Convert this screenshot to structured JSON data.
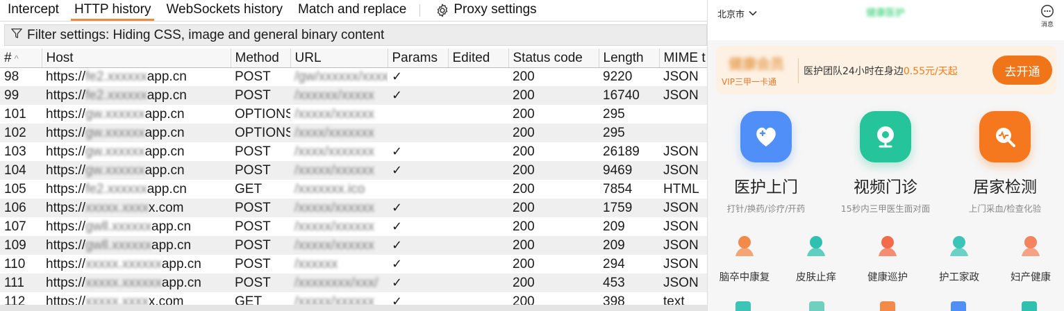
{
  "proxy": {
    "tabs": [
      "Intercept",
      "HTTP history",
      "WebSockets history",
      "Match and replace"
    ],
    "settings_label": "Proxy settings",
    "filter": "Filter settings: Hiding CSS, image and general binary content",
    "columns": [
      "#",
      "Host",
      "Method",
      "URL",
      "Params",
      "Edited",
      "Status code",
      "Length",
      "MIME t"
    ],
    "rows": [
      {
        "num": "98",
        "host": "https://fe2.xxxxxxapp.cn",
        "method": "POST",
        "url": "/gw/xxxxxx/xxxxx",
        "params": "✓",
        "status": "200",
        "length": "9220",
        "mime": "JSON"
      },
      {
        "num": "99",
        "host": "https://fe2.xxxxxxapp.cn",
        "method": "POST",
        "url": "/xxxxxx/xxxxx",
        "params": "✓",
        "status": "200",
        "length": "16740",
        "mime": "JSON"
      },
      {
        "num": "101",
        "host": "https://gw.xxxxxxapp.cn",
        "method": "OPTIONS",
        "url": "/xxxxx/xxxxxx",
        "params": "",
        "status": "200",
        "length": "295",
        "mime": ""
      },
      {
        "num": "102",
        "host": "https://gw.xxxxxxapp.cn",
        "method": "OPTIONS",
        "url": "/xxxx/xxxxxxx",
        "params": "",
        "status": "200",
        "length": "295",
        "mime": ""
      },
      {
        "num": "103",
        "host": "https://gw.xxxxxxapp.cn",
        "method": "POST",
        "url": "/xxxx/xxxxxxx",
        "params": "✓",
        "status": "200",
        "length": "26189",
        "mime": "JSON"
      },
      {
        "num": "104",
        "host": "https://gw.xxxxxxapp.cn",
        "method": "POST",
        "url": "/xxxxx/xxxxxx",
        "params": "✓",
        "status": "200",
        "length": "9469",
        "mime": "JSON"
      },
      {
        "num": "105",
        "host": "https://fe2.xxxxxxapp.cn",
        "method": "GET",
        "url": "/xxxxxxx.ico",
        "params": "",
        "status": "200",
        "length": "7854",
        "mime": "HTML"
      },
      {
        "num": "106",
        "host": "https://xxxxx.xxxxx.com",
        "method": "POST",
        "url": "/xxxxx/xxxxxx",
        "params": "✓",
        "status": "200",
        "length": "1759",
        "mime": "JSON"
      },
      {
        "num": "107",
        "host": "https://gwll.xxxxxxapp.cn",
        "method": "POST",
        "url": "/xxxxx/xxxxxx",
        "params": "✓",
        "status": "200",
        "length": "209",
        "mime": "JSON"
      },
      {
        "num": "109",
        "host": "https://gwll.xxxxxxapp.cn",
        "method": "POST",
        "url": "/xxxxx/xxxxxx",
        "params": "✓",
        "status": "200",
        "length": "209",
        "mime": "JSON"
      },
      {
        "num": "110",
        "host": "https://xxxxx.xxxxxxapp.cn",
        "method": "POST",
        "url": "/xxxxxx",
        "params": "✓",
        "status": "200",
        "length": "294",
        "mime": "JSON"
      },
      {
        "num": "111",
        "host": "https://xxxxx.xxxxxxapp.cn",
        "method": "POST",
        "url": "/xxxxxxxx/xxx/",
        "params": "✓",
        "status": "200",
        "length": "453",
        "mime": "JSON"
      },
      {
        "num": "112",
        "host": "https://xxxxx.xxxxx.com",
        "method": "GET",
        "url": "/xxxxx/xxxxxx",
        "params": "✓",
        "status": "200",
        "length": "398",
        "mime": "text"
      }
    ]
  },
  "mobile": {
    "city": "北京市",
    "app_name": "健康医护",
    "message_label": "消息",
    "vip": {
      "logo": "健康会员",
      "sub": "VIP三甲一卡通",
      "text_main": "医护团队24小时在身边",
      "price": "0.55元/天起",
      "button": "去开通"
    },
    "services": [
      {
        "title": "医护上门",
        "sub": "打针/换药/诊疗/开药",
        "color": "#4f8ff7"
      },
      {
        "title": "视频门诊",
        "sub": "15秒内三甲医生面对面",
        "color": "#26c49a"
      },
      {
        "title": "居家检测",
        "sub": "上门采血/检查化验",
        "color": "#f5781f"
      }
    ],
    "categories": [
      {
        "label": "脑卒中康复",
        "color": "#f28a4a"
      },
      {
        "label": "皮肤止痒",
        "color": "#2fc0b0"
      },
      {
        "label": "健康巡护",
        "color": "#f26b4a"
      },
      {
        "label": "护工家政",
        "color": "#3cc4b6"
      },
      {
        "label": "妇产健康",
        "color": "#f3845f"
      }
    ],
    "colors": {
      "accent": "#f07418",
      "vip_bg": "#fdf1e4"
    }
  }
}
